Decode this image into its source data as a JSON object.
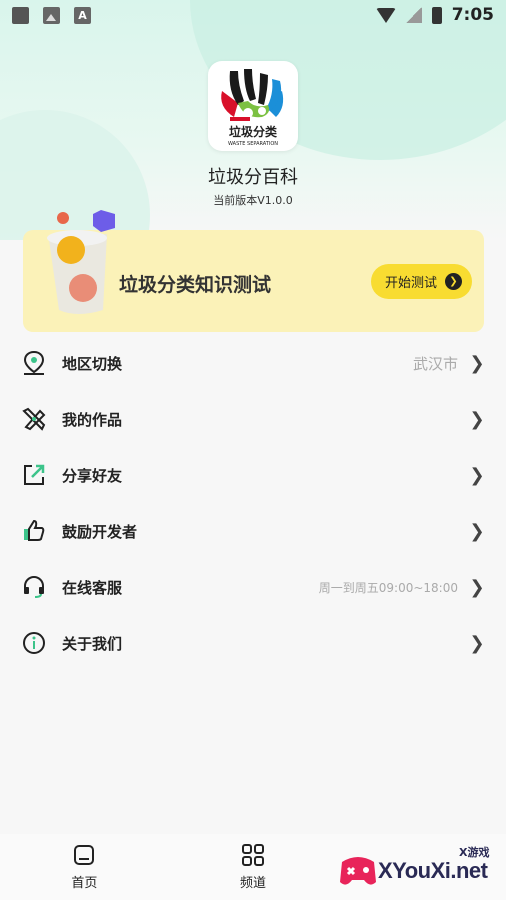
{
  "status_bar": {
    "time": "7:05"
  },
  "app": {
    "name": "垃圾分百科",
    "version": "当前版本V1.0.0",
    "logo_text": "垃圾分类",
    "logo_subtext": "WASTE SEPARATION"
  },
  "quiz": {
    "title": "垃圾分类知识测试",
    "button_label": "开始测试"
  },
  "menu": [
    {
      "label": "地区切换",
      "value": "武汉市",
      "icon": "location-pin-icon"
    },
    {
      "label": "我的作品",
      "value": "",
      "icon": "pencil-ruler-icon"
    },
    {
      "label": "分享好友",
      "value": "",
      "icon": "share-arrow-icon"
    },
    {
      "label": "鼓励开发者",
      "value": "",
      "icon": "thumbs-up-icon"
    },
    {
      "label": "在线客服",
      "value": "周一到周五09:00~18:00",
      "icon": "headset-icon"
    },
    {
      "label": "关于我们",
      "value": "",
      "icon": "info-icon"
    }
  ],
  "bottom_nav": [
    {
      "label": "首页",
      "icon": "home-icon"
    },
    {
      "label": "频道",
      "icon": "grid-icon"
    }
  ],
  "watermark": {
    "text": "XYouXi.net",
    "small": "X游戏"
  },
  "colors": {
    "accent_yellow": "#f8dc31",
    "card_bg": "#fbf2b8",
    "icon_green": "#3cc48a",
    "header_mint": "#d9f5ec"
  }
}
